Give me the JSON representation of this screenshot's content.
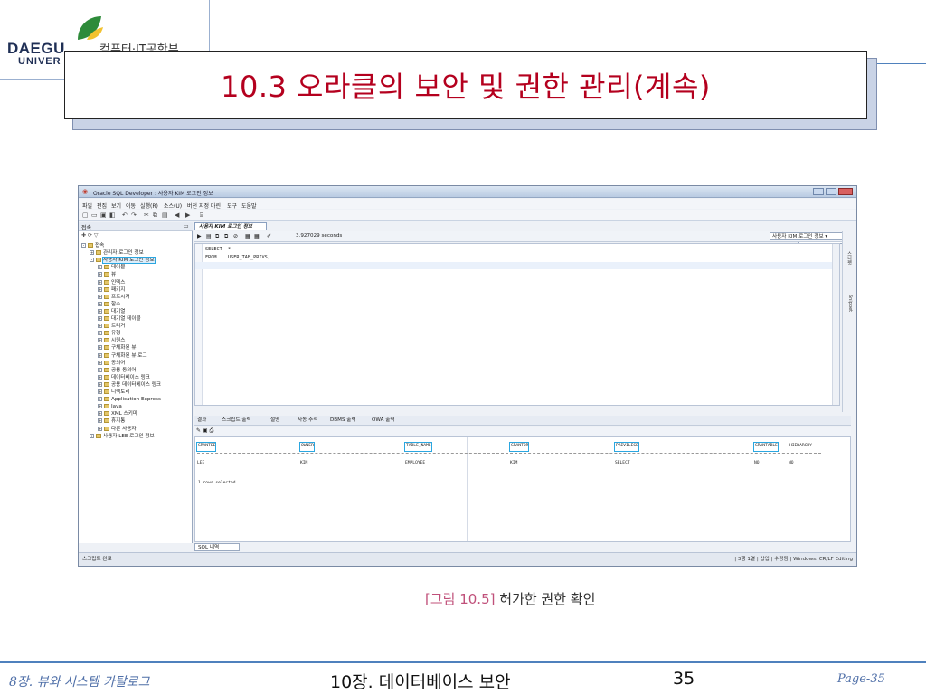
{
  "slide": {
    "logo": {
      "name": "DAEGU",
      "sub": "UNIVER",
      "dept": "컴퓨터·IT공학부"
    },
    "title": "10.3 오라클의 보안 및 권한 관리(계속)",
    "caption": {
      "number": "[그림 10.5]",
      "text": "허가한 권한 확인"
    },
    "footer": {
      "left": "8장. 뷰와 시스템 카탈로그",
      "center": "10장. 데이터베이스 보안",
      "page_number": "35",
      "right": "Page-35"
    }
  },
  "app": {
    "window_title": "Oracle SQL Developer : 사용자 KIM 로그인 정보",
    "menu": [
      "파일",
      "편집",
      "보기",
      "이동",
      "실행(R)",
      "소스(U)",
      "버전 지정",
      "마린",
      "도구",
      "도움말"
    ],
    "search_placeholder": "",
    "left_tab": "접속",
    "tree": [
      {
        "label": "접속",
        "indent": 0,
        "expander": "-"
      },
      {
        "label": "관리자 로그인 정보",
        "indent": 1,
        "expander": "+"
      },
      {
        "label": "사용자 KIM 로그인 정보",
        "indent": 1,
        "expander": "-",
        "highlight": true
      },
      {
        "label": "테이블",
        "indent": 2,
        "expander": "+"
      },
      {
        "label": "뷰",
        "indent": 2,
        "expander": "+"
      },
      {
        "label": "인덱스",
        "indent": 2,
        "expander": "+"
      },
      {
        "label": "패키지",
        "indent": 2,
        "expander": "+"
      },
      {
        "label": "프로시저",
        "indent": 2,
        "expander": "+"
      },
      {
        "label": "함수",
        "indent": 2,
        "expander": "+"
      },
      {
        "label": "대기열",
        "indent": 2,
        "expander": "+"
      },
      {
        "label": "대기열 테이블",
        "indent": 2,
        "expander": "+"
      },
      {
        "label": "트리거",
        "indent": 2,
        "expander": "+"
      },
      {
        "label": "유형",
        "indent": 2,
        "expander": "+"
      },
      {
        "label": "시퀀스",
        "indent": 2,
        "expander": "+"
      },
      {
        "label": "구체화된 뷰",
        "indent": 2,
        "expander": "+"
      },
      {
        "label": "구체화된 뷰 로그",
        "indent": 2,
        "expander": "+"
      },
      {
        "label": "동의어",
        "indent": 2,
        "expander": "+"
      },
      {
        "label": "공용 동의어",
        "indent": 2,
        "expander": "+"
      },
      {
        "label": "데이터베이스 링크",
        "indent": 2,
        "expander": "+"
      },
      {
        "label": "공용 데이터베이스 링크",
        "indent": 2,
        "expander": "+"
      },
      {
        "label": "디렉토리",
        "indent": 2,
        "expander": "+"
      },
      {
        "label": "Application Express",
        "indent": 2,
        "expander": "+"
      },
      {
        "label": "Java",
        "indent": 2,
        "expander": "+"
      },
      {
        "label": "XML 스키마",
        "indent": 2,
        "expander": "+"
      },
      {
        "label": "휴지통",
        "indent": 2,
        "expander": "+"
      },
      {
        "label": "다른 사용자",
        "indent": 2,
        "expander": "+"
      },
      {
        "label": "사용자 LEE 로그인 정보",
        "indent": 1,
        "expander": "+"
      }
    ],
    "doc_tab": "사용자 KIM 로그인 정보",
    "elapsed": "3.927029 seconds",
    "connection": "사용자 KIM 로그인 정보 ▾",
    "code_lines": [
      "SELECT  *",
      "FROM    USER_TAB_PRIVS;"
    ],
    "side_tabs": [
      "스니펫",
      "Snippet"
    ],
    "output_tabs": [
      "결과",
      "스크립트 출력",
      "설명",
      "자동 추적",
      "DBMS 출력",
      "OWA 출력"
    ],
    "results": {
      "columns": [
        "GRANTEE",
        "OWNER",
        "TABLE_NAME",
        "GRANTOR",
        "PRIVILEGE",
        "GRANTABLE",
        "HIERARCHY"
      ],
      "row": [
        "LEE",
        "KIM",
        "EMPLOYEE",
        "KIM",
        "SELECT",
        "NO",
        "NO"
      ],
      "rows_selected": "1 rows selected"
    },
    "history_tab": "SQL 내역",
    "status_left": "스크립트 완료",
    "status_right": "| 3행 1열  | 삽입  | 수정됨 | Windows: CR/LF Editing"
  },
  "colors": {
    "title": "#b4001e",
    "accent_line": "#4f81bd",
    "highlight": "#2aa6e0",
    "caption_number": "#c0507a"
  },
  "icons": [
    "logo-leaf-icon",
    "folder-icon",
    "run-icon",
    "save-icon",
    "search-icon"
  ]
}
